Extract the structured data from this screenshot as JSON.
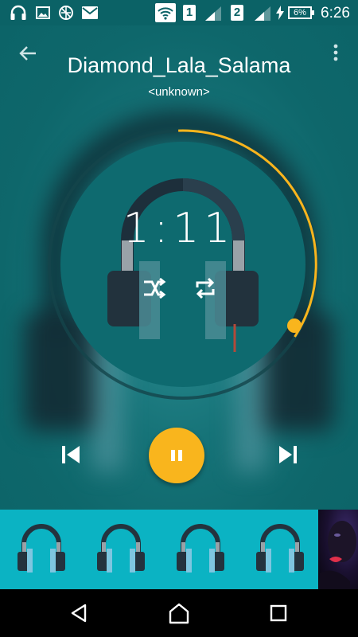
{
  "status_bar": {
    "sim1": "1",
    "sim2": "2",
    "battery": "6%",
    "time": "6:26",
    "icons": [
      "headphones-icon",
      "image-icon",
      "no-sync-icon",
      "mail-icon",
      "wifi-icon",
      "signal-icon",
      "signal-icon",
      "charging-icon"
    ]
  },
  "player": {
    "title": "Diamond_Lala_Salama",
    "artist": "<unknown>",
    "time_display": "1:11",
    "progress_fraction": 0.33,
    "accent_color": "#f9b51d",
    "background_color": "#0c6468",
    "state": "playing"
  },
  "controls": {
    "icons": [
      "shuffle-icon",
      "repeat-icon",
      "previous-icon",
      "pause-icon",
      "next-icon"
    ]
  },
  "album_strip": {
    "items": [
      {
        "icon": "headphones-art-icon"
      },
      {
        "icon": "headphones-art-icon"
      },
      {
        "icon": "headphones-art-icon"
      },
      {
        "icon": "headphones-art-icon"
      }
    ],
    "strip_color": "#0bb3c3"
  },
  "nav_bar": {
    "icons": [
      "back-triangle-icon",
      "home-icon",
      "recents-icon"
    ]
  }
}
